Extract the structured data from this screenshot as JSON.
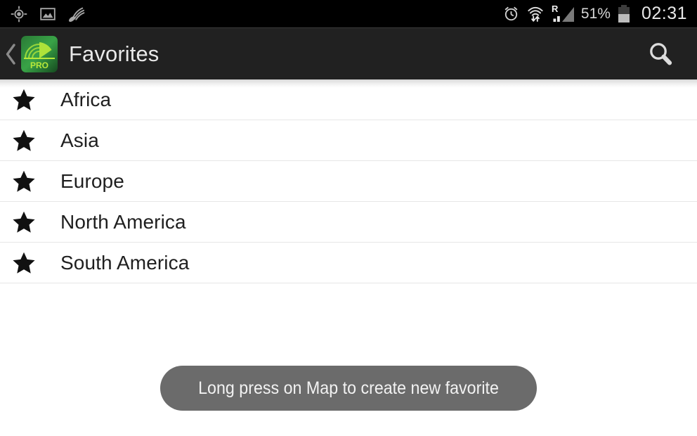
{
  "status_bar": {
    "background_color": "#000000",
    "left_icons": [
      {
        "name": "gps-location-icon",
        "label": "GPS location"
      },
      {
        "name": "screenshot-image-icon",
        "label": "Screenshot captured"
      },
      {
        "name": "satellite-signal-icon",
        "label": "Satellite signal"
      }
    ],
    "right_icons": [
      {
        "name": "alarm-clock-icon",
        "label": "Alarm set"
      },
      {
        "name": "wifi-data-transfer-icon",
        "label": "Wi-Fi with data transfer"
      },
      {
        "name": "roaming-signal-icon",
        "label": "Roaming"
      }
    ],
    "roaming_letter": "R",
    "battery_percent": "51%",
    "clock": "02:31"
  },
  "action_bar": {
    "background_color": "#212121",
    "back_icon": "chevron-left-icon",
    "app_icon": {
      "name": "app-logo-icon",
      "badge_text": "PRO",
      "colors": {
        "dark": "#1d5c2a",
        "mid": "#2e8b3c",
        "accent": "#a8e02a"
      }
    },
    "title": "Favorites",
    "search_icon": "search-icon"
  },
  "favorites": {
    "items": [
      {
        "icon": "star-icon",
        "label": "Africa"
      },
      {
        "icon": "star-icon",
        "label": "Asia"
      },
      {
        "icon": "star-icon",
        "label": "Europe"
      },
      {
        "icon": "star-icon",
        "label": "North America"
      },
      {
        "icon": "star-icon",
        "label": "South America"
      }
    ],
    "separator_color": "#e6e6e6"
  },
  "toast": {
    "message": "Long press on Map to create new favorite",
    "background_color": "#6b6b6b",
    "text_color": "#f2f2f2"
  }
}
